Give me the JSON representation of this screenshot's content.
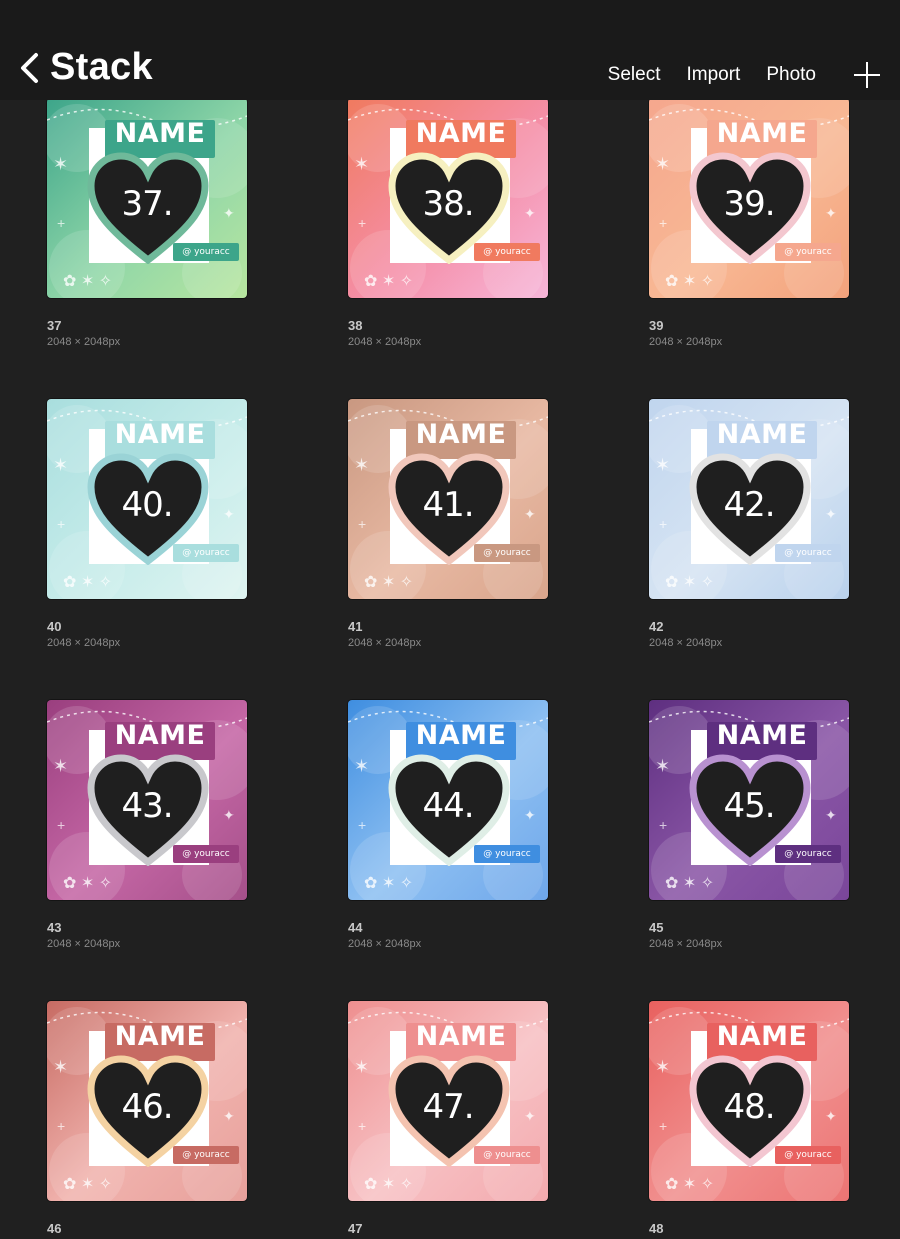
{
  "header": {
    "title": "Stack",
    "actions": [
      "Select",
      "Import",
      "Photo"
    ]
  },
  "colors": {
    "background": "#202020",
    "topbar": "#1a1a1a",
    "heart": "#1f1f1f"
  },
  "artwork": {
    "name_text": "NAME",
    "tag_text": "@ youracc"
  },
  "items": [
    {
      "label": "37",
      "size": "2048 × 2048px",
      "number": "37.",
      "colors": [
        "#3da58a",
        "#8fd6a8",
        "#b8e6a0"
      ],
      "outline": "#6fb99a"
    },
    {
      "label": "38",
      "size": "2048 × 2048px",
      "number": "38.",
      "colors": [
        "#f07a5f",
        "#f58fa8",
        "#f6b6d9"
      ],
      "outline": "#f6f0c0"
    },
    {
      "label": "39",
      "size": "2048 × 2048px",
      "number": "39.",
      "colors": [
        "#f5a78e",
        "#f8b894",
        "#f3a27c"
      ],
      "outline": "#f3c7cf"
    },
    {
      "label": "40",
      "size": "2048 × 2048px",
      "number": "40.",
      "colors": [
        "#a9dede",
        "#c6ecea",
        "#dff4f1"
      ],
      "outline": "#9ad3d6"
    },
    {
      "label": "41",
      "size": "2048 × 2048px",
      "number": "41.",
      "colors": [
        "#c99881",
        "#e8b9a3",
        "#d9a58c"
      ],
      "outline": "#f1c7bb"
    },
    {
      "label": "42",
      "size": "2048 × 2048px",
      "number": "42.",
      "colors": [
        "#c0d5ee",
        "#d6e4f3",
        "#b9d1ec"
      ],
      "outline": "#e2e2e2"
    },
    {
      "label": "43",
      "size": "2048 × 2048px",
      "number": "43.",
      "colors": [
        "#9a3f7f",
        "#c567a5",
        "#a5508a"
      ],
      "outline": "#c8c8cc"
    },
    {
      "label": "44",
      "size": "2048 × 2048px",
      "number": "44.",
      "colors": [
        "#3f8ee0",
        "#8ec0f2",
        "#6fa7ea"
      ],
      "outline": "#dfeee6"
    },
    {
      "label": "45",
      "size": "2048 × 2048px",
      "number": "45.",
      "colors": [
        "#5e2f80",
        "#8a56a6",
        "#7a469a"
      ],
      "outline": "#b891d0"
    },
    {
      "label": "46",
      "size": "",
      "number": "46.",
      "colors": [
        "#c76b63",
        "#f1b3ae",
        "#e7a09b"
      ],
      "outline": "#f4d2a2"
    },
    {
      "label": "47",
      "size": "",
      "number": "47.",
      "colors": [
        "#ee8f8f",
        "#f7c1c4",
        "#f3aaae"
      ],
      "outline": "#f4c3b0"
    },
    {
      "label": "48",
      "size": "",
      "number": "48.",
      "colors": [
        "#e8615f",
        "#f1908f",
        "#ec7473"
      ],
      "outline": "#f3c6d1"
    }
  ]
}
